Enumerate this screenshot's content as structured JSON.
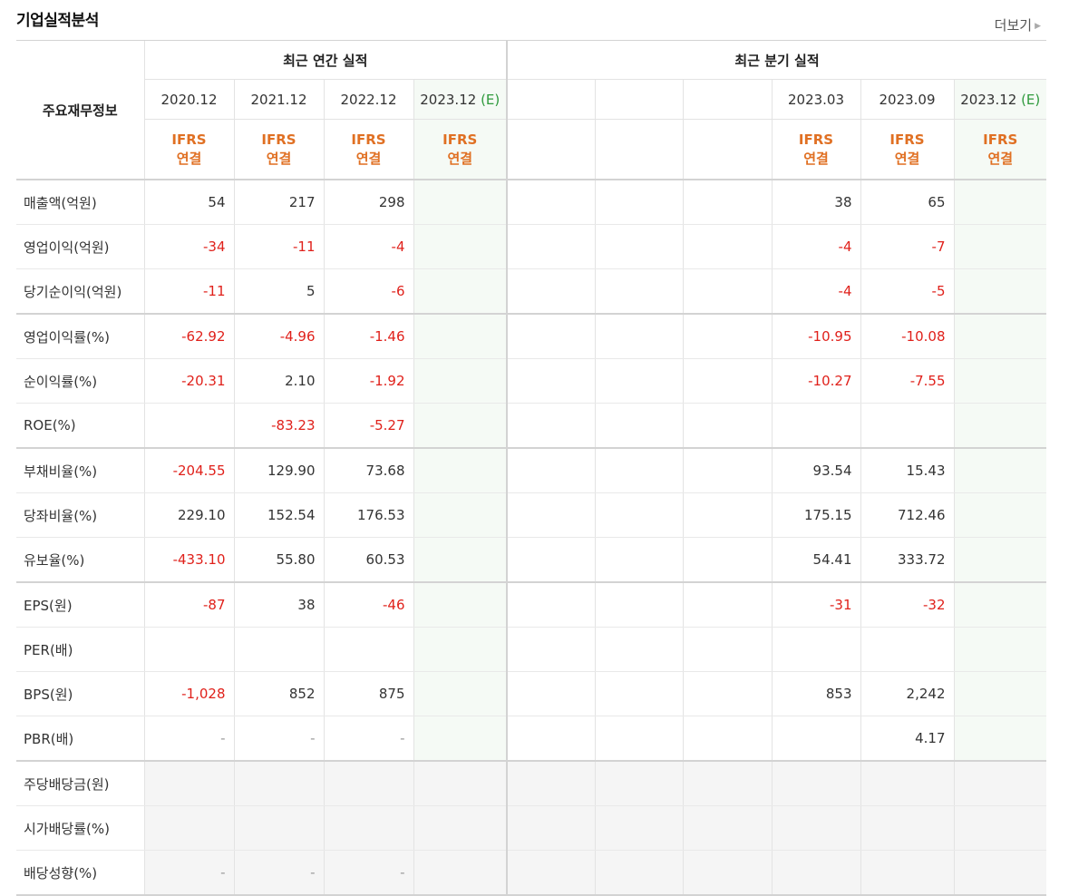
{
  "header": {
    "title": "기업실적분석",
    "more_label": "더보기"
  },
  "table": {
    "row_header": "주요재무정보",
    "annual_group": "최근 연간 실적",
    "quarter_group": "최근 분기 실적",
    "annual_periods": [
      "2020.12",
      "2021.12",
      "2022.12",
      "2023.12"
    ],
    "quarter_periods": [
      "",
      "",
      "",
      "2023.03",
      "2023.09",
      "2023.12"
    ],
    "estimate_mark": "(E)",
    "ifrs_line1": "IFRS",
    "ifrs_line2": "연결",
    "rows": [
      {
        "label": "매출액(억원)",
        "cells": [
          "54",
          "217",
          "298",
          "",
          "",
          "",
          "",
          "38",
          "65",
          ""
        ]
      },
      {
        "label": "영업이익(억원)",
        "cells": [
          "-34",
          "-11",
          "-4",
          "",
          "",
          "",
          "",
          "-4",
          "-7",
          ""
        ]
      },
      {
        "label": "당기순이익(억원)",
        "cells": [
          "-11",
          "5",
          "-6",
          "",
          "",
          "",
          "",
          "-4",
          "-5",
          ""
        ]
      },
      {
        "label": "영업이익률(%)",
        "cells": [
          "-62.92",
          "-4.96",
          "-1.46",
          "",
          "",
          "",
          "",
          "-10.95",
          "-10.08",
          ""
        ]
      },
      {
        "label": "순이익률(%)",
        "cells": [
          "-20.31",
          "2.10",
          "-1.92",
          "",
          "",
          "",
          "",
          "-10.27",
          "-7.55",
          ""
        ]
      },
      {
        "label": "ROE(%)",
        "cells": [
          "",
          "-83.23",
          "-5.27",
          "",
          "",
          "",
          "",
          "",
          "",
          ""
        ]
      },
      {
        "label": "부채비율(%)",
        "cells": [
          "-204.55",
          "129.90",
          "73.68",
          "",
          "",
          "",
          "",
          "93.54",
          "15.43",
          ""
        ]
      },
      {
        "label": "당좌비율(%)",
        "cells": [
          "229.10",
          "152.54",
          "176.53",
          "",
          "",
          "",
          "",
          "175.15",
          "712.46",
          ""
        ]
      },
      {
        "label": "유보율(%)",
        "cells": [
          "-433.10",
          "55.80",
          "60.53",
          "",
          "",
          "",
          "",
          "54.41",
          "333.72",
          ""
        ]
      },
      {
        "label": "EPS(원)",
        "cells": [
          "-87",
          "38",
          "-46",
          "",
          "",
          "",
          "",
          "-31",
          "-32",
          ""
        ]
      },
      {
        "label": "PER(배)",
        "cells": [
          "",
          "",
          "",
          "",
          "",
          "",
          "",
          "",
          "",
          ""
        ]
      },
      {
        "label": "BPS(원)",
        "cells": [
          "-1,028",
          "852",
          "875",
          "",
          "",
          "",
          "",
          "853",
          "2,242",
          ""
        ]
      },
      {
        "label": "PBR(배)",
        "cells": [
          "-",
          "-",
          "-",
          "",
          "",
          "",
          "",
          "",
          "4.17",
          ""
        ]
      },
      {
        "label": "주당배당금(원)",
        "cells": [
          "",
          "",
          "",
          "",
          "",
          "",
          "",
          "",
          "",
          ""
        ]
      },
      {
        "label": "시가배당률(%)",
        "cells": [
          "",
          "",
          "",
          "",
          "",
          "",
          "",
          "",
          "",
          ""
        ]
      },
      {
        "label": "배당성향(%)",
        "cells": [
          "-",
          "-",
          "-",
          "",
          "",
          "",
          "",
          "",
          "",
          ""
        ]
      }
    ]
  }
}
